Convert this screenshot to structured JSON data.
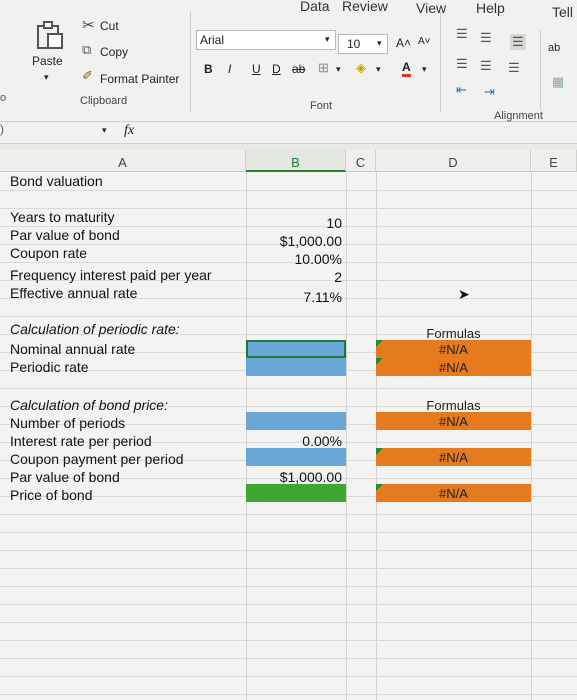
{
  "ribbon": {
    "tabs": [
      "Data",
      "Review",
      "View",
      "Help",
      "Tell"
    ],
    "clipboard": {
      "paste": "Paste",
      "cut": "Cut",
      "copy": "Copy",
      "format_painter": "Format Painter",
      "group": "Clipboard"
    },
    "font": {
      "name": "Arial",
      "size": "10",
      "bold": "B",
      "italic": "I",
      "underline": "U",
      "double_underline": "D",
      "strike": "ab",
      "grow": "A˄",
      "shrink": "A˅",
      "color": "A",
      "group": "Font"
    },
    "alignment": {
      "group": "Alignment",
      "wrap": "ab"
    }
  },
  "formula_bar": {
    "fx": "fx"
  },
  "columns": [
    "A",
    "B",
    "C",
    "D",
    "E"
  ],
  "sheet": {
    "title": "Bond valuation",
    "inputs": [
      {
        "label": "Years to maturity",
        "value": "10"
      },
      {
        "label": "Par value of bond",
        "value": "$1,000.00"
      },
      {
        "label": "Coupon rate",
        "value": "10.00%"
      },
      {
        "label": "Frequency interest paid per year",
        "value": "2"
      },
      {
        "label": "Effective annual rate",
        "value": "7.11%"
      }
    ],
    "periodic": {
      "heading": "Calculation of periodic rate:",
      "rows": [
        "Nominal annual rate",
        "Periodic rate"
      ],
      "formulas_header": "Formulas",
      "formulas": [
        "#N/A",
        "#N/A"
      ]
    },
    "price": {
      "heading": "Calculation of bond price:",
      "rows": [
        "Number of periods",
        "Interest rate per period",
        "Coupon payment per period",
        "Par value of bond",
        "Price of bond"
      ],
      "values": [
        "",
        "0.00%",
        "",
        "$1,000.00",
        ""
      ],
      "formulas_header": "Formulas",
      "formulas": [
        "#N/A",
        "#N/A",
        "#N/A"
      ]
    },
    "colors": {
      "blue_cell": "#6aa6d6",
      "orange_cell": "#e57a1e",
      "green_cell": "#3fa535",
      "selection": "#1f7a3a"
    }
  }
}
